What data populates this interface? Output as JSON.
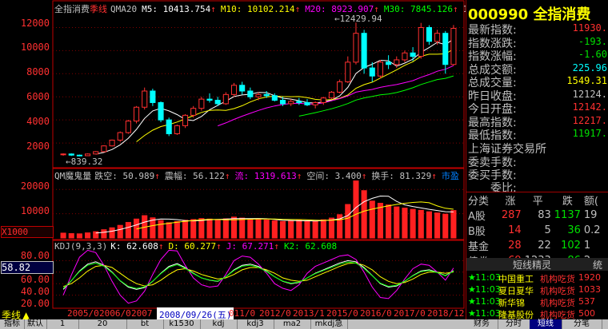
{
  "header": {
    "title": "全指消费",
    "period": "季线",
    "ma_prefix": "QMA20",
    "m5": "M5: 10413.754",
    "m10": "M10: 10102.214",
    "m20": "M20: 8923.907",
    "m30": "M30: 7845.126",
    "mtail": "11594",
    "arrow": "↑"
  },
  "volume_header": {
    "name": "QM魔鬼量",
    "jk": "跌空: 50.989",
    "zf": "震幅: 56.122",
    "liu": "流: 1319.613",
    "kj": "空间: 3.400",
    "hs": "换手: 81.329",
    "sc": "市盈"
  },
  "kdj_header": {
    "name": "KDJ(9,3,3)",
    "k": "K: 62.608",
    "d": "D: 60.277",
    "j": "J: 67.271",
    "k2": "K2: 62.608"
  },
  "annotations": {
    "high": "12429.94",
    "low": "839.32",
    "kdj_readout": "58.82",
    "vol_unit": "X1000",
    "bottom_period": "季线"
  },
  "axis": {
    "price_ticks": [
      "12000",
      "10000",
      "8000",
      "6000",
      "4000",
      "2000"
    ],
    "vol_ticks": [
      "20000",
      "10000"
    ],
    "kdj_ticks": [
      "80.00",
      "60.00",
      "40.00",
      "20.00"
    ]
  },
  "dates": [
    "2005/0",
    "2006/0",
    "2007",
    "2008/09/26(五)",
    "011/0",
    "2012/0",
    "2013/1",
    "2015/0",
    "2016/0",
    "2017/0",
    "2018/12"
  ],
  "panel": {
    "code": "000990",
    "name": "全指消费",
    "stats": [
      {
        "label": "最新指数:",
        "value": "11930.",
        "color": "#ff3030"
      },
      {
        "label": "指数涨跌:",
        "value": "-193.",
        "color": "#00e000"
      },
      {
        "label": "指数涨幅:",
        "value": "-1.60",
        "color": "#00e000"
      },
      {
        "label": "总成交额:",
        "value": "225.96",
        "color": "#00ffff"
      },
      {
        "label": "总成交量:",
        "value": "1549.31",
        "color": "#ffff00"
      },
      {
        "label": "昨日收盘:",
        "value": "12124.",
        "color": "#c0c0c0"
      },
      {
        "label": "今日开盘:",
        "value": "12142.",
        "color": "#ff3030"
      },
      {
        "label": "最高指数:",
        "value": "12217.",
        "color": "#ff3030"
      },
      {
        "label": "最低指数:",
        "value": "11917.",
        "color": "#00e000"
      }
    ],
    "exchange": "上海证券交易所",
    "extra": [
      "委卖手数:",
      "委买手数:",
      "委比:"
    ],
    "category_header": [
      "分类",
      "涨",
      "平",
      "跌",
      "额("
    ],
    "categories": [
      {
        "name": "A股",
        "up": "287",
        "flat": "83",
        "down": "1137",
        "amt": "19"
      },
      {
        "name": "B股",
        "up": "14",
        "flat": "5",
        "down": "36",
        "amt": "0.2"
      },
      {
        "name": "基金",
        "up": "28",
        "flat": "22",
        "down": "102",
        "amt": "1"
      },
      {
        "name": "债券",
        "up": "69",
        "flat": "1233",
        "down": "86",
        "amt": "2"
      }
    ],
    "ticker_title": "短线精灵",
    "ticker_title_tail": "统",
    "ticker": [
      {
        "time": "11:03",
        "stock": "中国重工",
        "event": "机构吃货",
        "val": "1920"
      },
      {
        "time": "11:03",
        "stock": "夏日夏华",
        "event": "机构吃货",
        "val": "1033"
      },
      {
        "time": "11:03",
        "stock": "新华锦",
        "event": "机构吃货",
        "val": "537"
      },
      {
        "time": "11:03",
        "stock": "隆基股份",
        "event": "机构吃货",
        "val": "500"
      }
    ]
  },
  "bottom_tabs": [
    "指标",
    "默认",
    "1",
    "20",
    "bt",
    "k1530",
    "kdj",
    "kdj3",
    "ma2",
    "mkdj急",
    "财务",
    "分时",
    "短线",
    "分笔"
  ],
  "colors": {
    "up": "#ff3030",
    "down": "#00ffff",
    "ma5": "#ffffff",
    "ma10": "#ffff00",
    "ma20": "#ff00ff",
    "ma30": "#00ff00",
    "grid": "#800000"
  },
  "chart_data": {
    "type": "candlestick",
    "ylim": [
      0,
      13000
    ],
    "candles": [
      [
        1000,
        1100,
        900,
        1050
      ],
      [
        1050,
        1100,
        880,
        950
      ],
      [
        950,
        1000,
        839,
        900
      ],
      [
        900,
        1100,
        870,
        1050
      ],
      [
        1050,
        1300,
        1000,
        1250
      ],
      [
        1250,
        1800,
        1200,
        1750
      ],
      [
        1750,
        2300,
        1700,
        2250
      ],
      [
        2250,
        3000,
        2100,
        2900
      ],
      [
        2900,
        4000,
        2800,
        3900
      ],
      [
        3900,
        5200,
        3700,
        5100
      ],
      [
        5100,
        6800,
        4900,
        6500
      ],
      [
        6500,
        6700,
        5200,
        5500
      ],
      [
        5500,
        5600,
        3800,
        4000
      ],
      [
        4000,
        4200,
        2600,
        2800
      ],
      [
        2800,
        3600,
        2700,
        3500
      ],
      [
        3500,
        4500,
        3300,
        4400
      ],
      [
        4400,
        5200,
        4200,
        5000
      ],
      [
        5000,
        6000,
        4800,
        5800
      ],
      [
        5800,
        6300,
        5500,
        5700
      ],
      [
        5700,
        6000,
        5200,
        5400
      ],
      [
        5400,
        6400,
        5300,
        6200
      ],
      [
        6200,
        7200,
        6000,
        7000
      ],
      [
        7000,
        7300,
        6200,
        6500
      ],
      [
        6500,
        6800,
        5800,
        6000
      ],
      [
        6000,
        6400,
        5700,
        6200
      ],
      [
        6200,
        6500,
        5900,
        6100
      ],
      [
        6100,
        6300,
        5600,
        5700
      ],
      [
        5700,
        6000,
        5200,
        5400
      ],
      [
        5400,
        5800,
        5200,
        5600
      ],
      [
        5600,
        5900,
        5300,
        5500
      ],
      [
        5500,
        5800,
        5200,
        5300
      ],
      [
        5300,
        5600,
        5000,
        5500
      ],
      [
        5500,
        6000,
        5300,
        5900
      ],
      [
        5900,
        6500,
        5800,
        6400
      ],
      [
        6400,
        7500,
        6300,
        7300
      ],
      [
        7300,
        9500,
        7200,
        9000
      ],
      [
        9000,
        12429.94,
        8800,
        11500
      ],
      [
        11500,
        11800,
        8000,
        8500
      ],
      [
        8500,
        9000,
        7300,
        7800
      ],
      [
        7800,
        9200,
        7600,
        9000
      ],
      [
        9000,
        9600,
        8400,
        8800
      ],
      [
        8800,
        9500,
        8500,
        9200
      ],
      [
        9200,
        10000,
        9000,
        9800
      ],
      [
        9800,
        10300,
        9100,
        9500
      ],
      [
        9500,
        12400,
        9300,
        12000
      ],
      [
        12000,
        12200,
        10500,
        10800
      ],
      [
        10800,
        11800,
        10500,
        11500
      ],
      [
        11500,
        11700,
        8000,
        8800
      ],
      [
        8800,
        12217,
        8700,
        11930
      ]
    ],
    "volume": [
      2000,
      1800,
      1700,
      2100,
      2600,
      3400,
      4200,
      5200,
      6400,
      7800,
      9200,
      8300,
      7200,
      6300,
      6800,
      7300,
      7600,
      8000,
      7800,
      7500,
      7900,
      8600,
      8200,
      7600,
      7800,
      7400,
      7100,
      6800,
      7000,
      7300,
      7100,
      6900,
      7500,
      8200,
      9600,
      13800,
      23500,
      19500,
      15200,
      14300,
      13600,
      12800,
      12300,
      11800,
      11400,
      10800,
      10300,
      9800,
      11300
    ],
    "vol_ylim": [
      0,
      25000
    ],
    "kdj_k": [
      30,
      45,
      62,
      74,
      78,
      72,
      60,
      45,
      34,
      30,
      33,
      44,
      58,
      70,
      75,
      68,
      58,
      50,
      46,
      44,
      52,
      64,
      72,
      74,
      70,
      62,
      52,
      44,
      40,
      42,
      50,
      58,
      64,
      70,
      76,
      80,
      78,
      68,
      54,
      40,
      34,
      36,
      44,
      54,
      62,
      64,
      60,
      54,
      62.608
    ],
    "kdj_d": [
      35,
      40,
      50,
      62,
      70,
      72,
      68,
      58,
      48,
      40,
      36,
      38,
      46,
      56,
      64,
      66,
      62,
      56,
      52,
      48,
      50,
      56,
      64,
      68,
      68,
      64,
      58,
      50,
      46,
      44,
      46,
      52,
      58,
      64,
      70,
      75,
      76,
      72,
      64,
      52,
      44,
      40,
      42,
      48,
      56,
      60,
      60,
      58,
      60.277
    ],
    "kdj_j": [
      20,
      55,
      86,
      98,
      94,
      72,
      44,
      20,
      6,
      10,
      27,
      56,
      82,
      98,
      97,
      72,
      50,
      38,
      34,
      36,
      56,
      80,
      88,
      86,
      74,
      58,
      40,
      32,
      28,
      38,
      58,
      70,
      76,
      82,
      88,
      90,
      82,
      60,
      34,
      16,
      14,
      28,
      48,
      66,
      74,
      72,
      60,
      46,
      67.271
    ]
  }
}
